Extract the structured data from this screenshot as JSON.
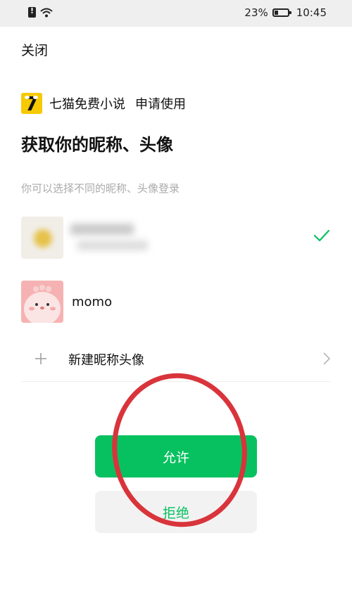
{
  "status_bar": {
    "battery_percent": "23%",
    "time": "10:45"
  },
  "header": {
    "close_label": "关闭"
  },
  "app": {
    "name": "七猫免费小说",
    "request_text": "申请使用"
  },
  "title": "获取你的昵称、头像",
  "subtitle": "你可以选择不同的昵称、头像登录",
  "accounts": [
    {
      "name": "",
      "selected": true
    },
    {
      "name": "momo",
      "selected": false
    }
  ],
  "new_profile_label": "新建昵称头像",
  "buttons": {
    "allow": "允许",
    "deny": "拒绝"
  },
  "colors": {
    "accent": "#07c160",
    "annotation": "#d9343b"
  }
}
